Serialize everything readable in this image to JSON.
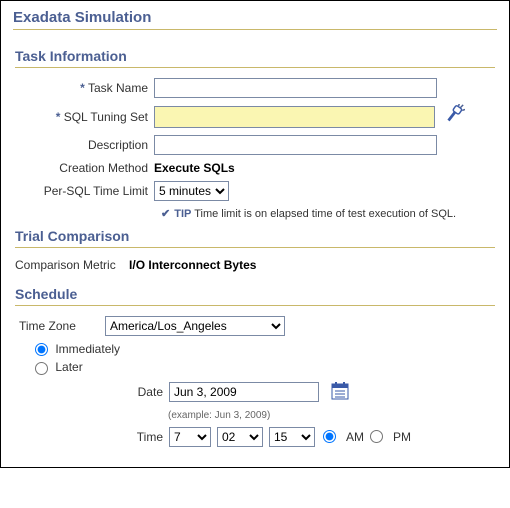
{
  "page_title": "Exadata Simulation",
  "task_info": {
    "header": "Task Information",
    "task_name_label": "Task Name",
    "task_name_value": "",
    "sts_label": "SQL Tuning Set",
    "sts_value": "",
    "description_label": "Description",
    "description_value": "",
    "creation_method_label": "Creation Method",
    "creation_method_value": "Execute SQLs",
    "per_sql_label": "Per-SQL Time Limit",
    "per_sql_selected": "5 minutes",
    "tip_label": "TIP",
    "tip_text": "Time limit is on elapsed time of test execution of SQL."
  },
  "trial": {
    "header": "Trial Comparison",
    "metric_label": "Comparison Metric",
    "metric_value": "I/O Interconnect Bytes"
  },
  "schedule": {
    "header": "Schedule",
    "tz_label": "Time Zone",
    "tz_selected": "America/Los_Angeles",
    "immediately_label": "Immediately",
    "later_label": "Later",
    "date_label": "Date",
    "date_value": "Jun 3, 2009",
    "date_example": "(example: Jun 3, 2009)",
    "time_label": "Time",
    "time_h": "7",
    "time_m": "02",
    "time_s": "15",
    "am_label": "AM",
    "pm_label": "PM"
  }
}
